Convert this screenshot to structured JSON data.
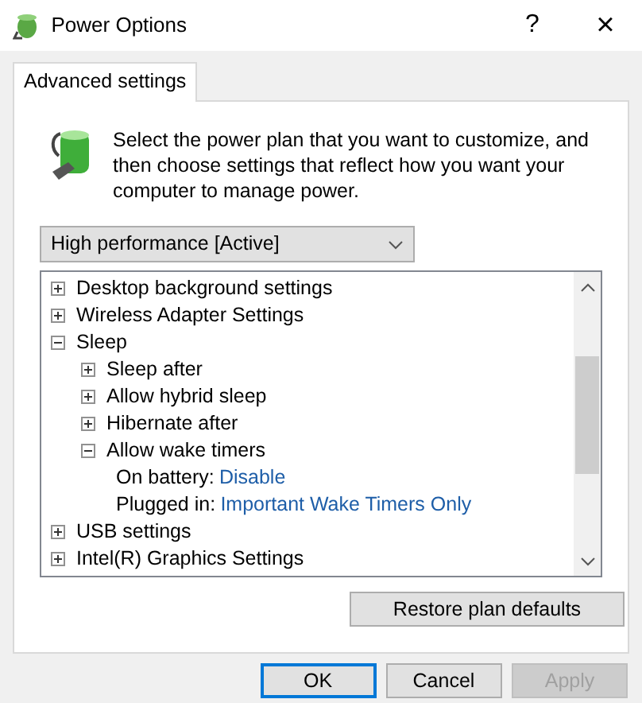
{
  "window": {
    "title": "Power Options",
    "help_button": "?",
    "close_button": "×"
  },
  "tabs": [
    {
      "label": "Advanced settings",
      "selected": true
    }
  ],
  "intro": "Select the power plan that you want to customize, and then choose settings that reflect how you want your computer to manage power.",
  "plan_dropdown": {
    "value": "High performance [Active]"
  },
  "tree": [
    {
      "kind": "group",
      "label": "Desktop background settings",
      "expanded": false
    },
    {
      "kind": "group",
      "label": "Wireless Adapter Settings",
      "expanded": false
    },
    {
      "kind": "group",
      "label": "Sleep",
      "expanded": true,
      "children": [
        {
          "kind": "group",
          "label": "Sleep after",
          "expanded": false
        },
        {
          "kind": "group",
          "label": "Allow hybrid sleep",
          "expanded": false
        },
        {
          "kind": "group",
          "label": "Hibernate after",
          "expanded": false
        },
        {
          "kind": "group",
          "label": "Allow wake timers",
          "expanded": true,
          "children": [
            {
              "kind": "setting",
              "label": "On battery:",
              "value": "Disable"
            },
            {
              "kind": "setting",
              "label": "Plugged in:",
              "value": "Important Wake Timers Only"
            }
          ]
        }
      ]
    },
    {
      "kind": "group",
      "label": "USB settings",
      "expanded": false
    },
    {
      "kind": "group",
      "label": "Intel(R) Graphics Settings",
      "expanded": false
    }
  ],
  "restore_button": {
    "label": "Restore plan defaults"
  },
  "buttons": [
    {
      "label": "OK",
      "default": true,
      "disabled": false
    },
    {
      "label": "Cancel",
      "default": false,
      "disabled": false
    },
    {
      "label": "Apply",
      "default": false,
      "disabled": true
    }
  ]
}
